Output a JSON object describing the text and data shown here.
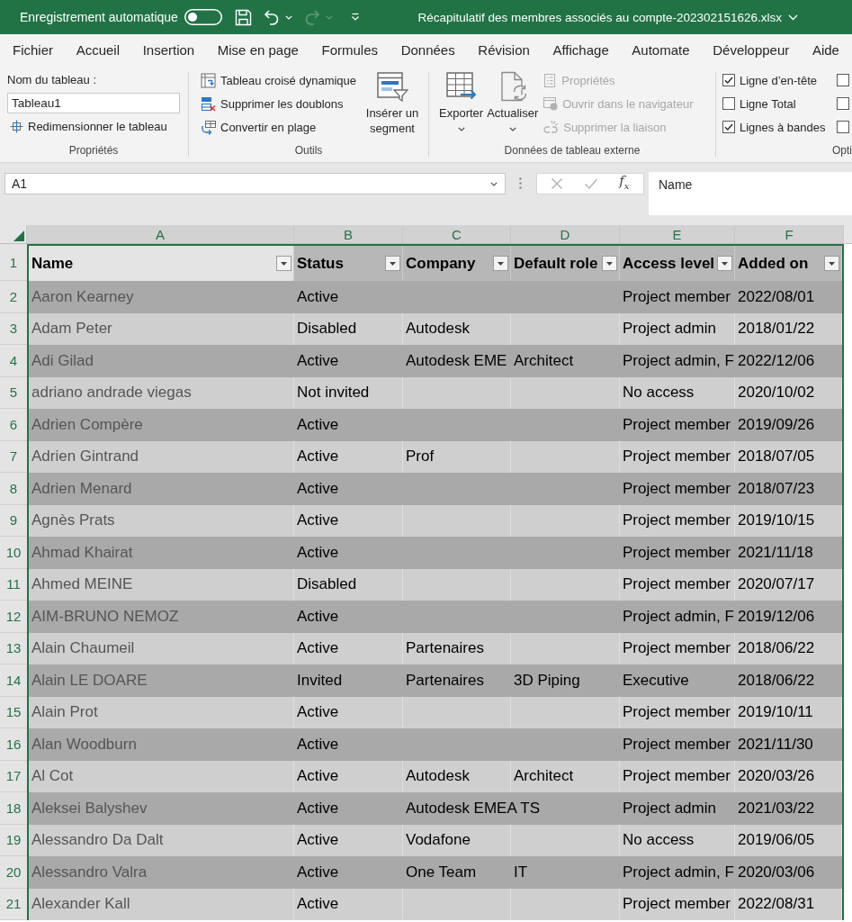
{
  "title_bar": {
    "autosave": {
      "label": "Enregistrement automatique",
      "on": false
    },
    "quick_access": [
      {
        "kind": "save",
        "disabled": false
      },
      {
        "kind": "undo",
        "disabled": false
      },
      {
        "kind": "redo",
        "disabled": true
      },
      {
        "kind": "customize",
        "disabled": false
      }
    ],
    "title": "Récapitulatif des membres associés au compte-202302151626.xlsx"
  },
  "menu_tabs": [
    {
      "label": "Fichier"
    },
    {
      "label": "Accueil"
    },
    {
      "label": "Insertion"
    },
    {
      "label": "Mise en page"
    },
    {
      "label": "Formules"
    },
    {
      "label": "Données"
    },
    {
      "label": "Révision"
    },
    {
      "label": "Affichage"
    },
    {
      "label": "Automate"
    },
    {
      "label": "Développeur"
    },
    {
      "label": "Aide"
    }
  ],
  "ribbon": {
    "properties": {
      "label": "Propriétés",
      "name_label": "Nom du tableau :",
      "name_value": "Tableau1",
      "resize_button": "Redimensionner le tableau"
    },
    "tools": {
      "label": "Outils",
      "commands": [
        {
          "kind": "pivot",
          "label": "Tableau croisé dynamique"
        },
        {
          "kind": "dedupe",
          "label": "Supprimer les doublons"
        },
        {
          "kind": "convert",
          "label": "Convertir en plage"
        }
      ],
      "slicer_button": "Insérer un segment"
    },
    "external_data": {
      "label": "Données de tableau externe",
      "large_buttons": [
        {
          "kind": "export",
          "label": "Exporter"
        },
        {
          "kind": "refresh",
          "label": "Actualiser"
        }
      ],
      "commands": [
        {
          "kind": "properties",
          "label": "Propriétés",
          "disabled": true
        },
        {
          "kind": "browser",
          "label": "Ouvrir dans le navigateur",
          "disabled": true
        },
        {
          "kind": "unlink",
          "label": "Supprimer la liaison",
          "disabled": true
        }
      ]
    },
    "style_options": {
      "label": "Opti",
      "columns": [
        {
          "items": [
            {
              "label": "Ligne d’en-tête",
              "checked": true
            },
            {
              "label": "Ligne Total",
              "checked": false
            },
            {
              "label": "Lignes à bandes",
              "checked": true
            }
          ]
        },
        {
          "items": [
            {
              "checked": false
            },
            {
              "checked": false
            },
            {
              "checked": false
            }
          ]
        }
      ]
    }
  },
  "formula_bar": {
    "name_box": "A1",
    "edit_buttons": [
      {
        "kind": "cancel",
        "disabled": true
      },
      {
        "kind": "enter",
        "disabled": true
      }
    ],
    "function_button": "f$_{x}$",
    "formula": "Name"
  },
  "sheet": {
    "column_headers": [
      {
        "letter": "A",
        "selected": true
      },
      {
        "letter": "B",
        "selected": true
      },
      {
        "letter": "C",
        "selected": true
      },
      {
        "letter": "D",
        "selected": true
      },
      {
        "letter": "E",
        "selected": true
      },
      {
        "letter": "F",
        "selected": true
      }
    ]
  },
  "table": {
    "header": {
      "row_number": "1",
      "selected": true,
      "columns": [
        {
          "label": "Name"
        },
        {
          "label": "Status"
        },
        {
          "label": "Company"
        },
        {
          "label": "Default role"
        },
        {
          "label": "Access level"
        },
        {
          "label": "Added on"
        }
      ]
    },
    "rows": [
      {
        "row_number": "2",
        "selected": true,
        "name": "Aaron Kearney",
        "status": "Active",
        "access_level": "Project member",
        "added_on": "2022/08/01"
      },
      {
        "row_number": "3",
        "selected": true,
        "name": "Adam Peter",
        "status": "Disabled",
        "company": "Autodesk",
        "access_level": "Project admin",
        "added_on": "2018/01/22"
      },
      {
        "row_number": "4",
        "selected": true,
        "name": "Adi Gilad",
        "status": "Active",
        "company": "Autodesk EME",
        "default_role": "Architect",
        "access_level": "Project admin, F",
        "added_on": "2022/12/06"
      },
      {
        "row_number": "5",
        "selected": true,
        "name": "adriano andrade viegas",
        "status": "Not invited",
        "access_level": "No access",
        "added_on": "2020/10/02"
      },
      {
        "row_number": "6",
        "selected": true,
        "name": "Adrien Compère",
        "status": "Active",
        "access_level": "Project member",
        "added_on": "2019/09/26"
      },
      {
        "row_number": "7",
        "selected": true,
        "name": "Adrien Gintrand",
        "status": "Active",
        "company": "Prof",
        "access_level": "Project member",
        "added_on": "2018/07/05"
      },
      {
        "row_number": "8",
        "selected": true,
        "name": "Adrien Menard",
        "status": "Active",
        "access_level": "Project member",
        "added_on": "2018/07/23"
      },
      {
        "row_number": "9",
        "selected": true,
        "name": "Agnès Prats",
        "status": "Active",
        "access_level": "Project member",
        "added_on": "2019/10/15"
      },
      {
        "row_number": "10",
        "selected": true,
        "name": "Ahmad Khairat",
        "status": "Active",
        "access_level": "Project member",
        "added_on": "2021/11/18"
      },
      {
        "row_number": "11",
        "selected": true,
        "name": "Ahmed MEINE",
        "status": "Disabled",
        "access_level": "Project member",
        "added_on": "2020/07/17"
      },
      {
        "row_number": "12",
        "selected": true,
        "name": "AIM-BRUNO NEMOZ",
        "status": "Active",
        "access_level": "Project admin, F",
        "added_on": "2019/12/06"
      },
      {
        "row_number": "13",
        "selected": true,
        "name": "Alain Chaumeil",
        "status": "Active",
        "company": "Partenaires",
        "access_level": "Project member",
        "added_on": "2018/06/22"
      },
      {
        "row_number": "14",
        "selected": true,
        "name": "Alain LE DOARE",
        "status": "Invited",
        "company": "Partenaires",
        "default_role": "3D Piping",
        "access_level": "Executive",
        "added_on": "2018/06/22"
      },
      {
        "row_number": "15",
        "selected": true,
        "name": "Alain Prot",
        "status": "Active",
        "access_level": "Project member",
        "added_on": "2019/10/11"
      },
      {
        "row_number": "16",
        "selected": true,
        "name": "Alan Woodburn",
        "status": "Active",
        "access_level": "Project member",
        "added_on": "2021/11/30"
      },
      {
        "row_number": "17",
        "selected": true,
        "name": "Al Cot",
        "status": "Active",
        "company": "Autodesk",
        "default_role": "Architect",
        "access_level": "Project member",
        "added_on": "2020/03/26"
      },
      {
        "row_number": "18",
        "selected": true,
        "name": "Aleksei Balyshev",
        "status": "Active",
        "company": "Autodesk EMEA TS",
        "access_level": "Project admin",
        "added_on": "2021/03/22"
      },
      {
        "row_number": "19",
        "selected": true,
        "name": "Alessandro Da Dalt",
        "status": "Active",
        "company": "Vodafone",
        "access_level": "No access",
        "added_on": "2019/06/05"
      },
      {
        "row_number": "20",
        "selected": true,
        "name": "Alessandro Valra",
        "status": "Active",
        "company": "One Team",
        "default_role": "IT",
        "access_level": "Project admin, F",
        "added_on": "2020/03/06"
      },
      {
        "row_number": "21",
        "selected": true,
        "name": "Alexander Kall",
        "status": "Active",
        "access_level": "Project member",
        "added_on": "2022/08/31"
      }
    ]
  }
}
